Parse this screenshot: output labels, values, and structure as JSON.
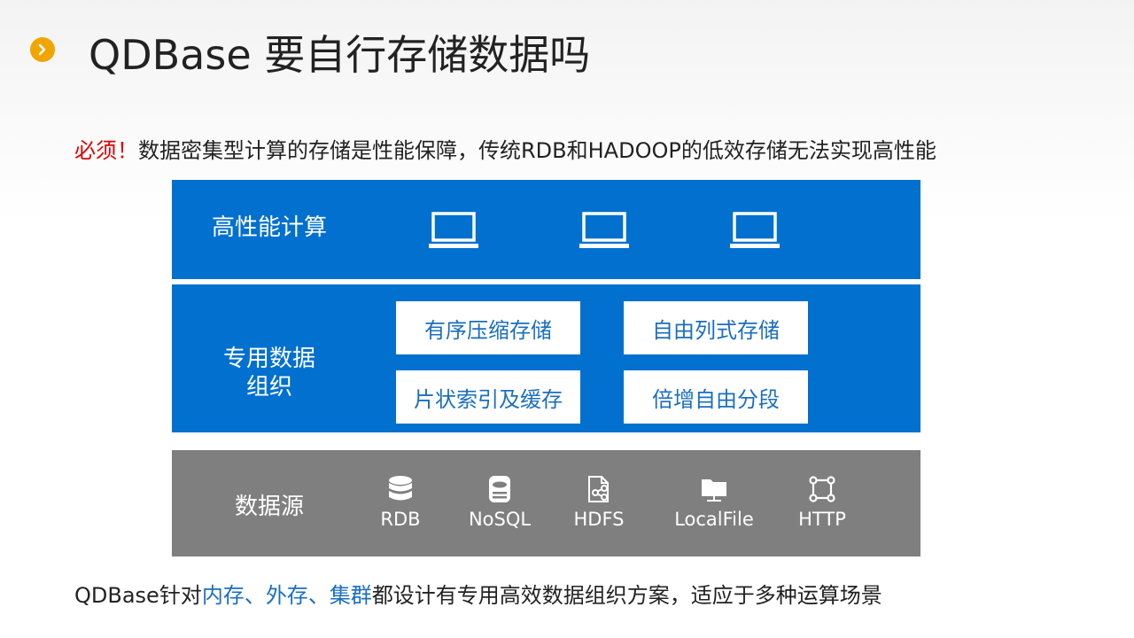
{
  "title": "QDBase 要自行存储数据吗",
  "subtitle": {
    "emphasis": "必须！",
    "text": "数据密集型计算的存储是性能保障，传统RDB和HADOOP的低效存储无法实现高性能"
  },
  "layers": {
    "compute": {
      "label": "高性能计算",
      "icons": [
        "laptop-icon",
        "laptop-icon",
        "laptop-icon"
      ]
    },
    "organization": {
      "label_line1": "专用数据",
      "label_line2": "组织",
      "tiles": [
        "有序压缩存储",
        "自由列式存储",
        "片状索引及缓存",
        "倍增自由分段"
      ]
    },
    "source": {
      "label": "数据源",
      "items": [
        {
          "label": "RDB",
          "icon": "database-icon"
        },
        {
          "label": "NoSQL",
          "icon": "disk-icon"
        },
        {
          "label": "HDFS",
          "icon": "file-share-icon"
        },
        {
          "label": "LocalFile",
          "icon": "folder-icon"
        },
        {
          "label": "HTTP",
          "icon": "network-icon"
        }
      ]
    }
  },
  "footer": {
    "pre": "QDBase针对",
    "hl1": "内存",
    "sep1": "、",
    "hl2": "外存",
    "sep2": "、",
    "hl3": "集群",
    "post": "都设计有专用高效数据组织方案，适应于多种运算场景"
  },
  "colors": {
    "primary_blue": "#0170cf",
    "source_gray": "#7f7f7f",
    "accent_orange": "#f0a500",
    "emphasis_red": "#e00000",
    "highlight_blue": "#1a6fc0"
  }
}
